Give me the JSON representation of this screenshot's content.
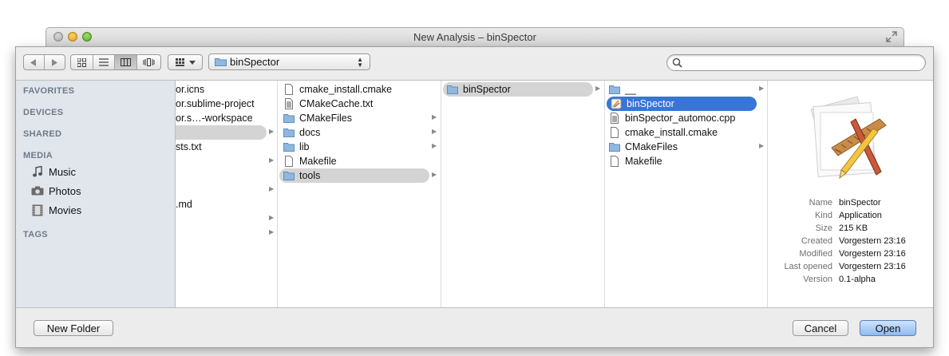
{
  "window": {
    "title": "New Analysis – binSpector"
  },
  "toolbar": {
    "location": "binSpector",
    "search_placeholder": ""
  },
  "sidebar": {
    "favorites": "FAVORITES",
    "devices": "DEVICES",
    "shared": "SHARED",
    "media": "MEDIA",
    "media_items": [
      "Music",
      "Photos",
      "Movies"
    ],
    "tags": "TAGS"
  },
  "columns": {
    "col1": [
      "or.icns",
      "or.sublime-project",
      "or.s…-workspace",
      "",
      "sts.txt",
      "",
      "",
      ".md"
    ],
    "col2": [
      "cmake_install.cmake",
      "CMakeCache.txt",
      "CMakeFiles",
      "docs",
      "lib",
      "Makefile",
      "tools"
    ],
    "col3": [
      "binSpector"
    ],
    "col4": [
      "__",
      "binSpector",
      "binSpector_automoc.cpp",
      "cmake_install.cmake",
      "CMakeFiles",
      "Makefile"
    ]
  },
  "preview": {
    "labels": [
      "Name",
      "Kind",
      "Size",
      "Created",
      "Modified",
      "Last opened",
      "Version"
    ],
    "values": [
      "binSpector",
      "Application",
      "215 KB",
      "Vorgestern 23:16",
      "Vorgestern 23:16",
      "Vorgestern 23:16",
      "0.1-alpha"
    ]
  },
  "buttons": {
    "new_folder": "New Folder",
    "cancel": "Cancel",
    "open": "Open"
  }
}
